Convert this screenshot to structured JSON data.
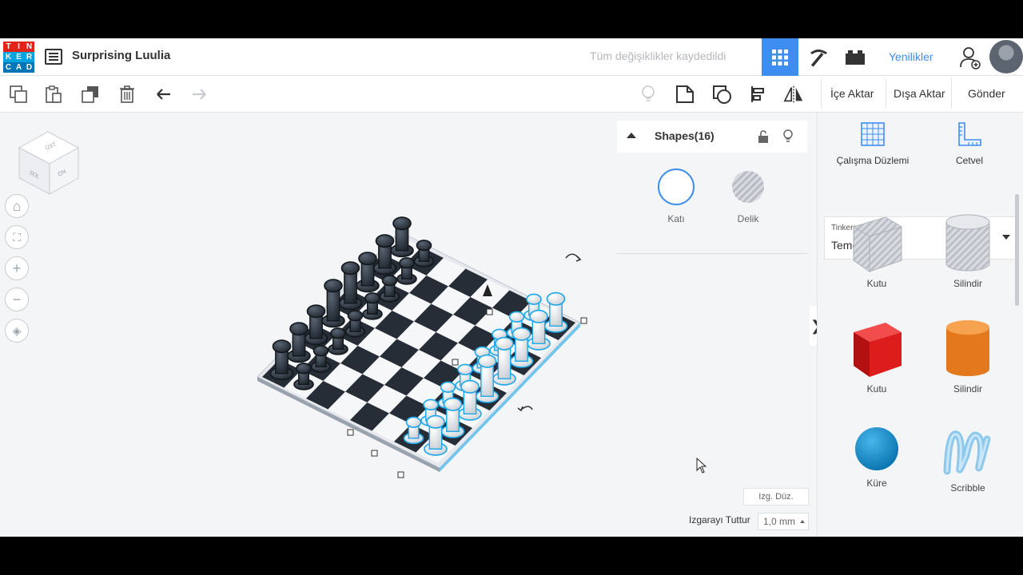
{
  "app": {
    "logo_letters": [
      "T",
      "I",
      "N",
      "K",
      "E",
      "R",
      "C",
      "A",
      "D"
    ],
    "logo_colors": [
      "#e2231a",
      "#e2231a",
      "#e2231a",
      "#00a3e0",
      "#00a3e0",
      "#00a3e0",
      "#0076b6",
      "#0076b6",
      "#0076b6"
    ],
    "design_title": "Surprising Luulia",
    "save_status": "Tüm değişiklikler kaydedildi",
    "news_label": "Yenilikler",
    "accent": "#3d8ef0"
  },
  "toolbar": {
    "copy_icon": "copy-icon",
    "paste_icon": "paste-icon",
    "duplicate_icon": "duplicate-icon",
    "delete_icon": "trash-icon",
    "undo_icon": "undo-icon",
    "redo_icon": "redo-icon",
    "import_label": "İçe Aktar",
    "export_label": "Dışa Aktar",
    "send_label": "Gönder"
  },
  "viewcube": {
    "top": "ÜST",
    "left": "SOL",
    "front": "ÖN"
  },
  "inspector": {
    "title": "Shapes(16)",
    "solid_label": "Katı",
    "hole_label": "Delik"
  },
  "viewport_controls": {
    "grid_edit": "Izg. Düz.",
    "snap_label": "Izgarayı Tuttur",
    "snap_value": "1,0 mm"
  },
  "library": {
    "workplane_label": "Çalışma Düzlemi",
    "ruler_label": "Cetvel",
    "category_source": "Tinkercad",
    "category_name": "Temel Şekiller",
    "shapes": [
      {
        "label": "Kutu",
        "kind": "box-hole"
      },
      {
        "label": "Silindir",
        "kind": "cylinder-hole"
      },
      {
        "label": "Kutu",
        "kind": "box-red"
      },
      {
        "label": "Silindir",
        "kind": "cylinder-orange"
      },
      {
        "label": "Küre",
        "kind": "sphere-blue"
      },
      {
        "label": "Scribble",
        "kind": "scribble"
      }
    ]
  }
}
